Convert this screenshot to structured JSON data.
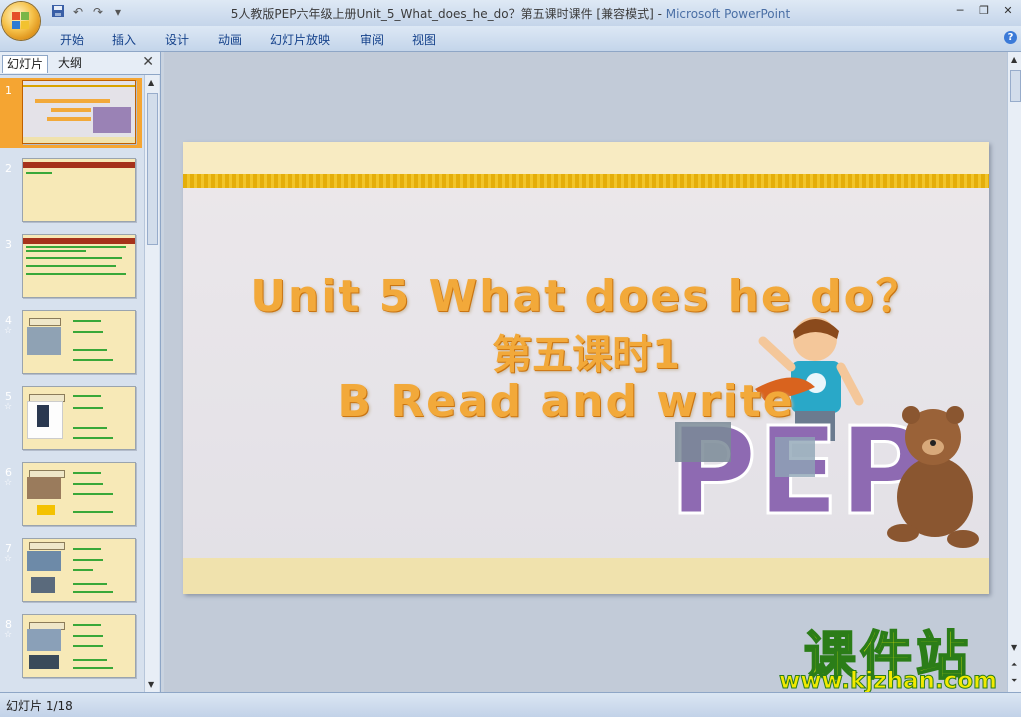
{
  "window": {
    "title_doc": "5人教版PEP六年级上册Unit_5_What_does_he_do？第五课时课件 [兼容模式]",
    "title_sep": " - ",
    "title_app": "Microsoft PowerPoint"
  },
  "ribbon": {
    "tabs": [
      "开始",
      "插入",
      "设计",
      "动画",
      "幻灯片放映",
      "审阅",
      "视图"
    ]
  },
  "panel": {
    "tab_slides": "幻灯片",
    "tab_outline": "大纲",
    "thumbnails": [
      {
        "num": "1",
        "selected": true,
        "anim": false
      },
      {
        "num": "2",
        "selected": false,
        "anim": false
      },
      {
        "num": "3",
        "selected": false,
        "anim": false
      },
      {
        "num": "4",
        "selected": false,
        "anim": true
      },
      {
        "num": "5",
        "selected": false,
        "anim": true
      },
      {
        "num": "6",
        "selected": false,
        "anim": true
      },
      {
        "num": "7",
        "selected": false,
        "anim": true
      },
      {
        "num": "8",
        "selected": false,
        "anim": true
      }
    ]
  },
  "slide": {
    "line1": "Unit 5 What does he do？",
    "line2": "第五课时1",
    "line3": "B Read and write",
    "decoration": "PEP"
  },
  "status": {
    "slide_counter": "幻灯片 1/18"
  },
  "watermark": {
    "brand": "课件站",
    "url": "www.kjzhan.com"
  },
  "colors": {
    "title_orange": "#f2a93a",
    "selected_thumb": "#f5a532",
    "stripe_gold": "#e4ae0a",
    "watermark_yellow": "#f6f30a"
  }
}
